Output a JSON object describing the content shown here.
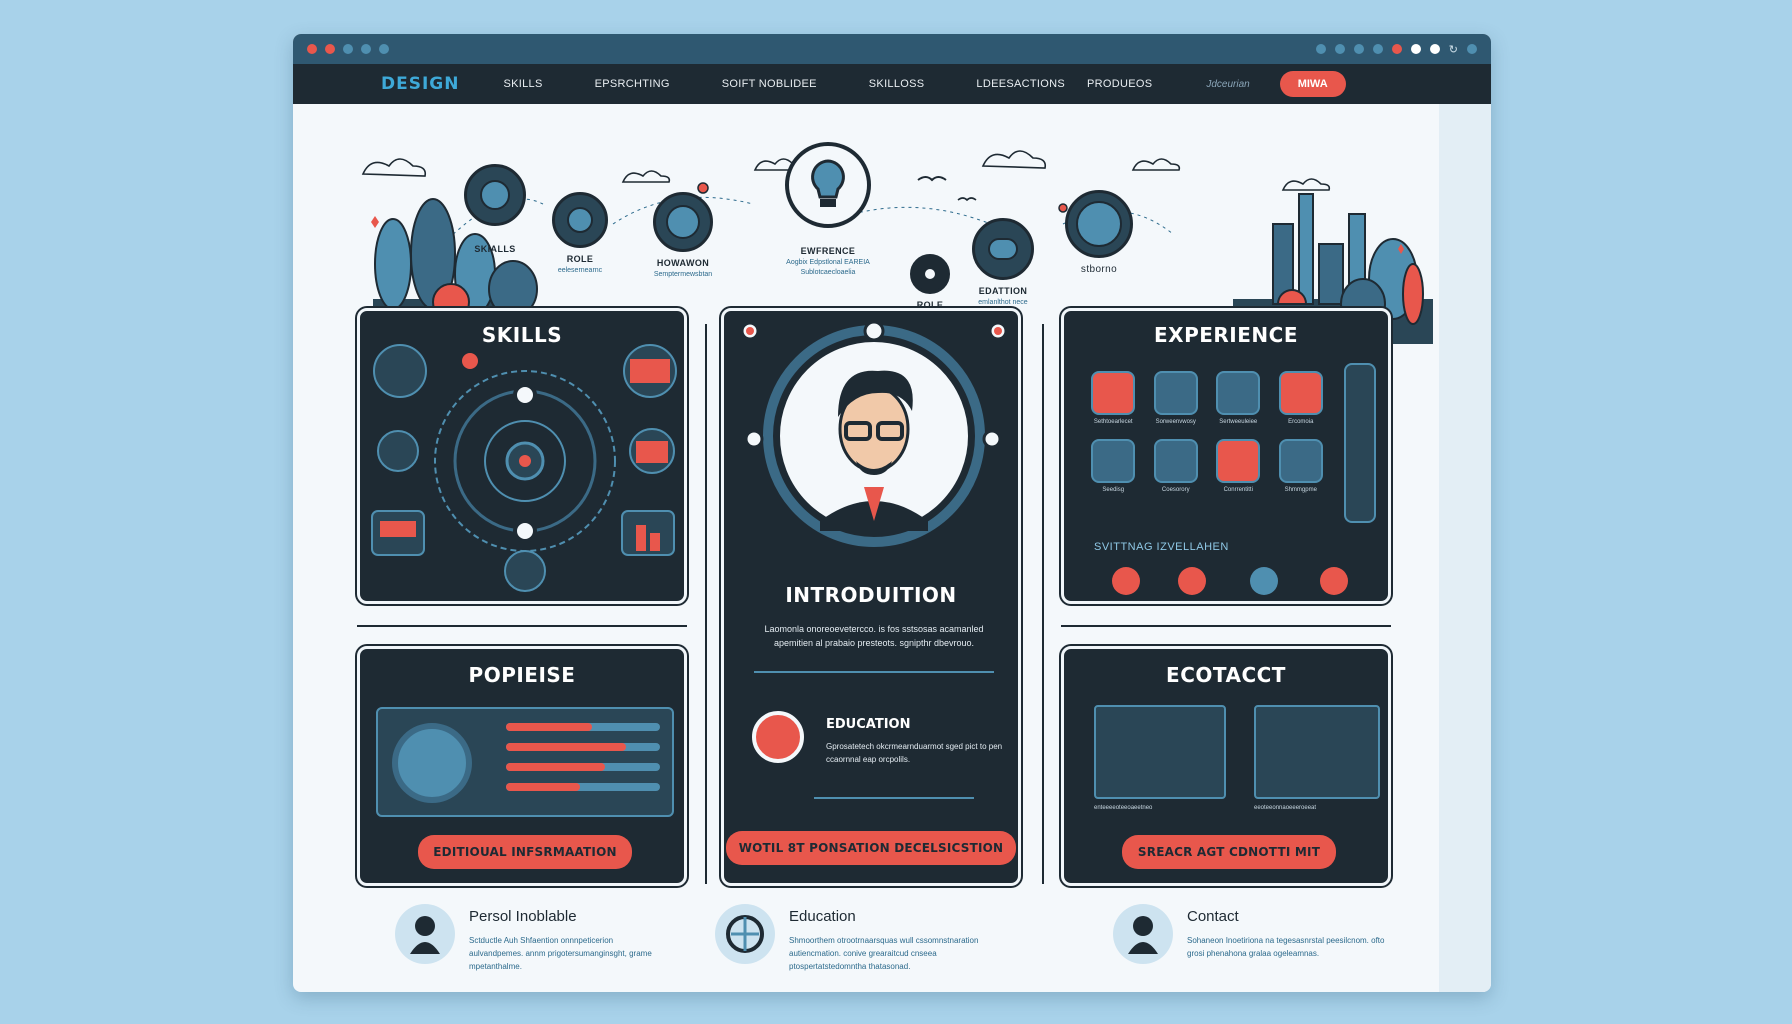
{
  "nav": {
    "brand": "DESIGN",
    "links": [
      "SKILLS",
      "EPSRCHTING",
      "SOIFT NOBLIDEE",
      "SKILLOSS",
      "LDEESACTIONS",
      "PRODUEOS"
    ],
    "muted_link": "Jdceurian",
    "button": "MIWA"
  },
  "hero": {
    "items": [
      {
        "label": "SKIALLS",
        "sub": ""
      },
      {
        "label": "ROLE",
        "sub": "eelesernearnc"
      },
      {
        "label": "HOWAWON",
        "sub": "Semptermewsbtan"
      },
      {
        "label": "EWFRENCE",
        "sub": "Aogbix Edpstlonal EAREIA"
      },
      {
        "label": "",
        "sub": "Sublotcaecloaelia"
      },
      {
        "label": "ROLE",
        "sub": ""
      },
      {
        "label": "EDATTION",
        "sub": "emlanlthot nece"
      },
      {
        "label": "stborno",
        "sub": ""
      }
    ]
  },
  "panels": {
    "skills": {
      "title": "SKILLS"
    },
    "intro": {
      "title": "INTRODUITION",
      "text": "Laomonla onoreoevetercco. is fos sstsosas acamanled apemitien al prabaio presteots. sgnipthr dbevrouo.",
      "edu_title": "EDUCATION",
      "edu_text": "Gprosatetech okcrmearnduarmot sged pict to pen ccaornnal eap orcpolils.",
      "button": "WOTIL 8T PONSATION DECELSICSTION"
    },
    "experience": {
      "title": "EXPERIENCE",
      "items": [
        "Sethtoearlecet",
        "Sorweenvwosy",
        "Sertweeuleiee",
        "Ercomoia",
        "Seedisg",
        "Coesorory",
        "Conrrentitti",
        "Shmmgpme"
      ],
      "sub_title": "SVITTNAG IZVELLAHEN"
    },
    "portfolio": {
      "title": "POPIEISE",
      "button": "EDITIOUAL INFSRMAATION"
    },
    "contact": {
      "title": "ECOTACCT",
      "caption_left": "enteeeeoteeoaeetneo",
      "caption_right": "eeoteeonnaoeeeroeeat",
      "button": "SREACR AGT CDNOTTI MIT"
    }
  },
  "bottom": [
    {
      "title": "Persol Inoblable",
      "text": "Sctductle Auh Shfaention onnnpeticerion aulvandpemes. annm prigotersumanginsght, grame mpetanthalme."
    },
    {
      "title": "Education",
      "text": "Shmoorthem otrootrnaarsquas wull cssomnstnaration autiencmation. conive grearaitcud cnseea ptospertatstedomntha thatasonad."
    },
    {
      "title": "Contact",
      "text": "Sohaneon Inoetiriona na tegesasnrstal peesilcnom. ofto grosi phenahona gralaa ogeleamnas."
    }
  ],
  "colors": {
    "accent": "#e8574c",
    "dark": "#1e2a33",
    "brand": "#3ea9d8",
    "background": "#a8d2ea"
  }
}
